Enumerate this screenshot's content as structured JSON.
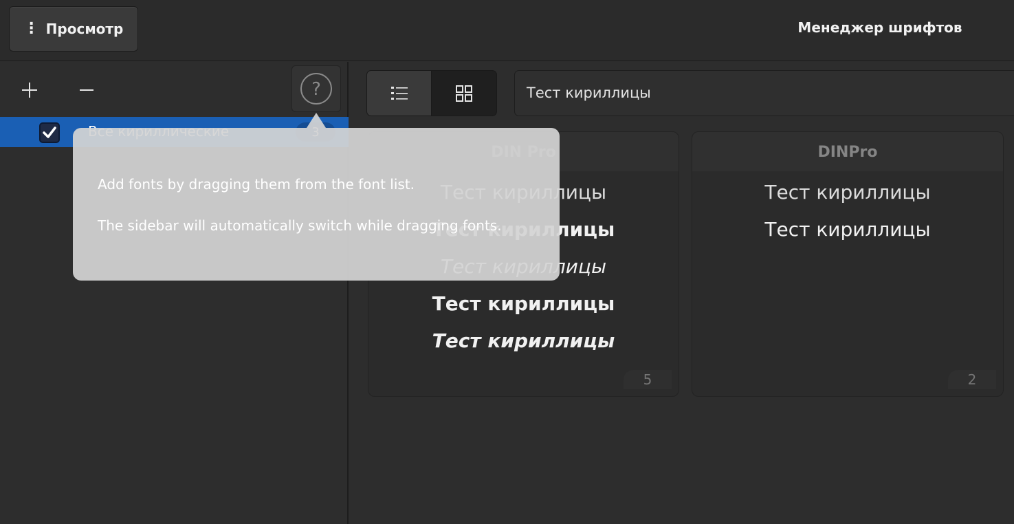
{
  "header": {
    "menu_label": "Просмотр",
    "title": "Менеджер шрифтов"
  },
  "sidebar": {
    "add_icon": "plus-icon",
    "remove_icon": "minus-icon",
    "help_icon": "question-circle-icon",
    "collections": [
      {
        "label": "Все кириллические",
        "count": "3",
        "checked": true
      }
    ]
  },
  "main": {
    "view_modes": [
      "list-view-icon",
      "grid-view-icon"
    ],
    "active_view": "list",
    "preview_text": "Тест кириллицы",
    "cards": [
      {
        "title": "DIN Pro",
        "samples": [
          "Тест кириллицы",
          "Тест кириллицы",
          "Тест кириллицы",
          "Тест кириллицы",
          "Тест кириллицы"
        ],
        "count": "5"
      },
      {
        "title": "DINPro",
        "samples": [
          "Тест кириллицы",
          "Тест кириллицы"
        ],
        "count": "2"
      }
    ]
  },
  "popover": {
    "line1": "Add fonts by dragging them from the font list.",
    "line2": "The sidebar will automatically switch while dragging fonts."
  },
  "colors": {
    "accent": "#1a5fb4",
    "background": "#2d2d2d",
    "headerbar": "#2b2b2b"
  }
}
